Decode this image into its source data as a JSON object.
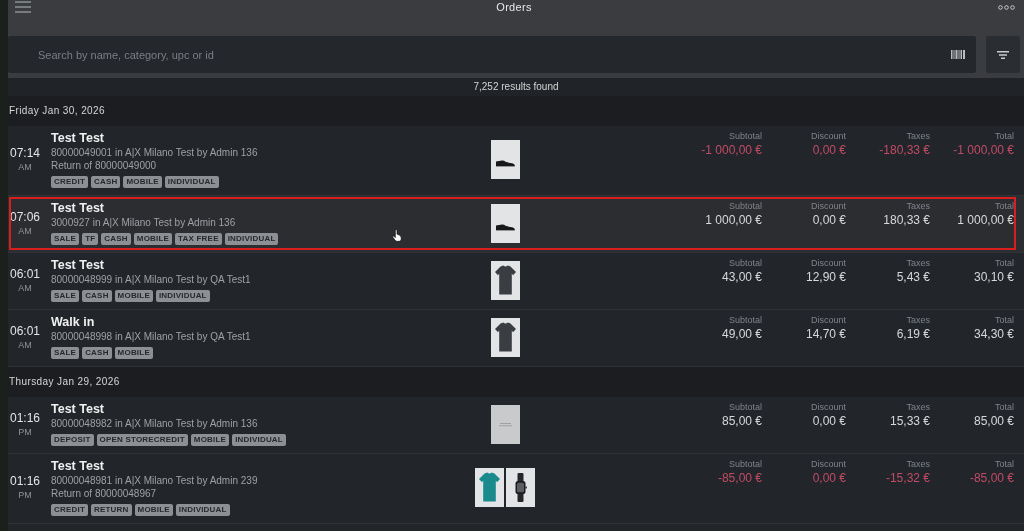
{
  "header": {
    "title": "Orders"
  },
  "search": {
    "placeholder": "Search by name, category, upc or id"
  },
  "results_count": "7,252 results found",
  "groups": [
    {
      "date": "Friday Jan 30, 2026",
      "orders": [
        {
          "time": "07:14",
          "period": "AM",
          "name": "Test Test",
          "info": "80000049001 in A|X Milano Test by Admin 136",
          "note": "Return of 80000049000",
          "tags": [
            "CREDIT",
            "CASH",
            "MOBILE",
            "INDIVIDUAL"
          ],
          "photos": [
            {
              "kind": "sneaker"
            }
          ],
          "refund": true,
          "selected": false,
          "amounts": [
            {
              "label": "Subtotal",
              "value": "-1 000,00 €"
            },
            {
              "label": "Discount",
              "value": "0,00 €"
            },
            {
              "label": "Taxes",
              "value": "-180,33 €"
            },
            {
              "label": "Total",
              "value": "-1 000,00 €"
            }
          ]
        },
        {
          "time": "07:06",
          "period": "AM",
          "name": "Test Test",
          "info": "3000927 in A|X Milano Test by Admin 136",
          "tags": [
            "SALE",
            "TF",
            "CASH",
            "MOBILE",
            "TAX FREE",
            "INDIVIDUAL"
          ],
          "photos": [
            {
              "kind": "sneaker"
            }
          ],
          "refund": false,
          "selected": true,
          "amounts": [
            {
              "label": "Subtotal",
              "value": "1 000,00 €"
            },
            {
              "label": "Discount",
              "value": "0,00 €"
            },
            {
              "label": "Taxes",
              "value": "180,33 €"
            },
            {
              "label": "Total",
              "value": "1 000,00 €"
            }
          ]
        },
        {
          "time": "06:01",
          "period": "AM",
          "name": "Test Test",
          "info": "80000048999 in A|X Milano Test by QA Test1",
          "tags": [
            "SALE",
            "CASH",
            "MOBILE",
            "INDIVIDUAL"
          ],
          "photos": [
            {
              "kind": "tshirt",
              "color": "#3a3d42"
            }
          ],
          "refund": false,
          "selected": false,
          "amounts": [
            {
              "label": "Subtotal",
              "value": "43,00 €"
            },
            {
              "label": "Discount",
              "value": "12,90 €"
            },
            {
              "label": "Taxes",
              "value": "5,43 €"
            },
            {
              "label": "Total",
              "value": "30,10 €"
            }
          ]
        },
        {
          "time": "06:01",
          "period": "AM",
          "name": "Walk in",
          "info": "80000048998 in A|X Milano Test by QA Test1",
          "tags": [
            "SALE",
            "CASH",
            "MOBILE"
          ],
          "photos": [
            {
              "kind": "tshirt",
              "color": "#3a3d42"
            }
          ],
          "refund": false,
          "selected": false,
          "amounts": [
            {
              "label": "Subtotal",
              "value": "49,00 €"
            },
            {
              "label": "Discount",
              "value": "14,70 €"
            },
            {
              "label": "Taxes",
              "value": "6,19 €"
            },
            {
              "label": "Total",
              "value": "34,30 €"
            }
          ]
        }
      ]
    },
    {
      "date": "Thursday Jan 29, 2026",
      "orders": [
        {
          "time": "01:16",
          "period": "PM",
          "name": "Test Test",
          "info": "80000048982 in A|X Milano Test by Admin 136",
          "tags": [
            "DEPOSIT",
            "OPEN STORECREDIT",
            "MOBILE",
            "INDIVIDUAL"
          ],
          "photos": [
            {
              "kind": "none"
            }
          ],
          "refund": false,
          "selected": false,
          "amounts": [
            {
              "label": "Subtotal",
              "value": "85,00 €"
            },
            {
              "label": "Discount",
              "value": "0,00 €"
            },
            {
              "label": "Taxes",
              "value": "15,33 €"
            },
            {
              "label": "Total",
              "value": "85,00 €"
            }
          ]
        },
        {
          "time": "01:16",
          "period": "PM",
          "name": "Test Test",
          "info": "80000048981 in A|X Milano Test by Admin 239",
          "note": "Return of 80000048967",
          "tags": [
            "CREDIT",
            "RETURN",
            "MOBILE",
            "INDIVIDUAL"
          ],
          "photos": [
            {
              "kind": "tshirt",
              "color": "#1a8a8d"
            },
            {
              "kind": "watch"
            }
          ],
          "refund": true,
          "selected": false,
          "amounts": [
            {
              "label": "Subtotal",
              "value": "-85,00 €"
            },
            {
              "label": "Discount",
              "value": "0,00 €"
            },
            {
              "label": "Taxes",
              "value": "-15,32 €"
            },
            {
              "label": "Total",
              "value": "-85,00 €"
            }
          ]
        }
      ]
    }
  ]
}
